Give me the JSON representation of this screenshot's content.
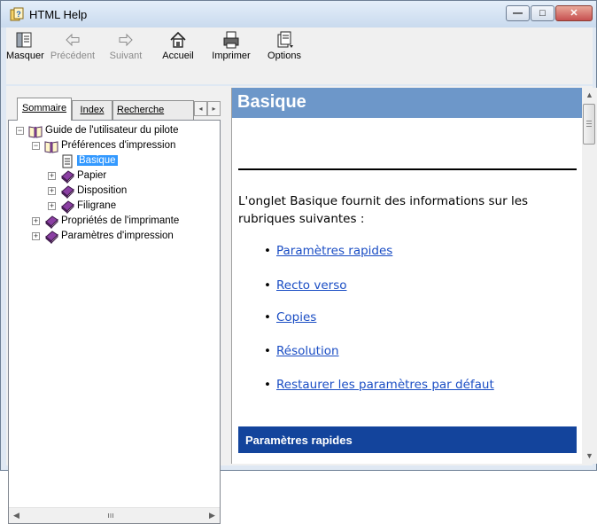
{
  "window": {
    "title": "HTML Help",
    "minimize_glyph": "—",
    "maximize_glyph": "□",
    "close_glyph": "✕"
  },
  "toolbar": {
    "hide": "Masquer",
    "back": "Précédent",
    "forward": "Suivant",
    "home": "Accueil",
    "print": "Imprimer",
    "options": "Options"
  },
  "nav": {
    "tabs": [
      "Sommaire",
      "Index",
      "Recherche"
    ],
    "active_tab": "Sommaire",
    "tree": [
      {
        "label": "Guide de l'utilisateur du pilote",
        "level": 0,
        "expander": "⊟",
        "icon": "open-book-icon"
      },
      {
        "label": "Préférences d'impression",
        "level": 1,
        "expander": "⊟",
        "icon": "open-book-icon"
      },
      {
        "label": "Basique",
        "level": 2,
        "expander": "",
        "icon": "page-icon",
        "selected": true
      },
      {
        "label": "Papier",
        "level": 2,
        "expander": "⊞",
        "icon": "closed-book-icon"
      },
      {
        "label": "Disposition",
        "level": 2,
        "expander": "⊞",
        "icon": "closed-book-icon"
      },
      {
        "label": "Filigrane",
        "level": 2,
        "expander": "⊞",
        "icon": "closed-book-icon"
      },
      {
        "label": "Propriétés de l'imprimante",
        "level": 1,
        "expander": "⊞",
        "icon": "closed-book-icon"
      },
      {
        "label": "Paramètres d'impression",
        "level": 1,
        "expander": "⊞",
        "icon": "closed-book-icon"
      }
    ]
  },
  "content": {
    "heading": "Basique",
    "intro": "L'onglet Basique fournit des informations sur les rubriques suivantes :",
    "links": [
      "Paramètres rapides",
      "Recto verso",
      "Copies",
      "Résolution",
      "Restaurer les paramètres par défaut"
    ],
    "bullet": "•",
    "section_title": "Paramètres rapides"
  },
  "colors": {
    "header_bg": "#6d97c9",
    "section_bg": "#13449c",
    "link": "#1a4dc4",
    "selection": "#3399ff"
  }
}
